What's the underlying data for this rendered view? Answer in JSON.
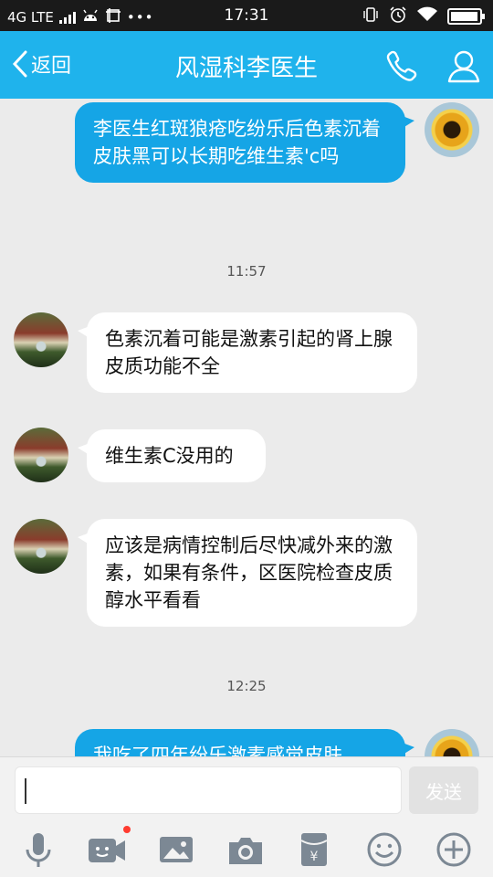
{
  "status_bar": {
    "network": "4G LTE",
    "time": "17:31"
  },
  "header": {
    "back_label": "返回",
    "title": "风湿科李医生"
  },
  "messages": [
    {
      "side": "out",
      "text": "李医生红斑狼疮吃纷乐后色素沉着皮肤黑可以长期吃维生素'c吗"
    },
    {
      "timestamp": "11:57"
    },
    {
      "side": "in",
      "text": "色素沉着可能是激素引起的肾上腺皮质功能不全"
    },
    {
      "side": "in",
      "text": "维生素C没用的"
    },
    {
      "side": "in",
      "text": "应该是病情控制后尽快减外来的激素，如果有条件，区医院检查皮质醇水平看看"
    },
    {
      "timestamp": "12:25"
    },
    {
      "side": "out",
      "text": "我吃了四年纷乐激素感觉皮肤"
    }
  ],
  "input": {
    "value": "",
    "send_label": "发送"
  },
  "toolbar": {
    "items": [
      "microphone-icon",
      "video-call-icon",
      "image-icon",
      "camera-icon",
      "red-packet-icon",
      "emoji-icon",
      "plus-icon"
    ],
    "video_badge": true
  },
  "colors": {
    "accent": "#1fb3ec",
    "outgoing_bubble": "#15a5e6",
    "incoming_bubble": "#ffffff",
    "chat_background": "#ebebeb",
    "badge": "#ff3b30"
  },
  "battery_level": 0.95
}
